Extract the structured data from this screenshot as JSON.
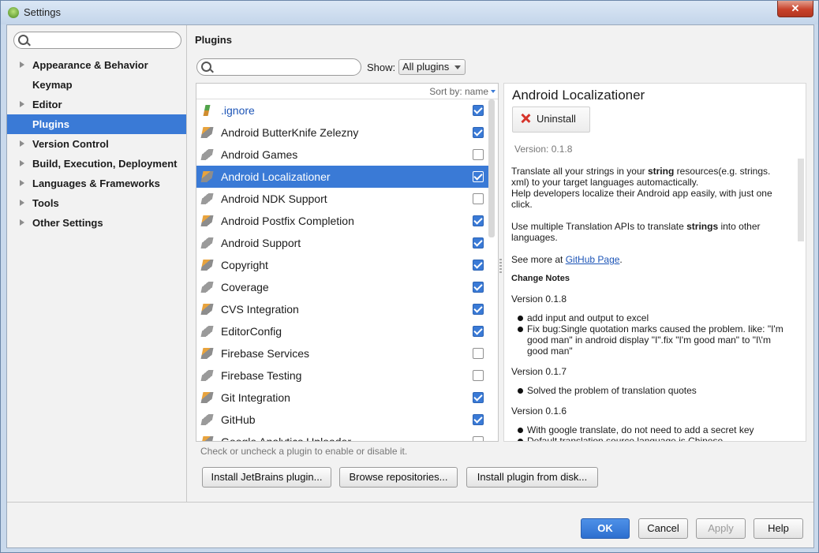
{
  "window": {
    "title": "Settings",
    "close_glyph": "✕"
  },
  "sidebar": {
    "search_placeholder": "",
    "items": [
      {
        "label": "Appearance & Behavior",
        "expandable": true
      },
      {
        "label": "Keymap",
        "expandable": false
      },
      {
        "label": "Editor",
        "expandable": true
      },
      {
        "label": "Plugins",
        "expandable": false,
        "selected": true
      },
      {
        "label": "Version Control",
        "expandable": true
      },
      {
        "label": "Build, Execution, Deployment",
        "expandable": true
      },
      {
        "label": "Languages & Frameworks",
        "expandable": true
      },
      {
        "label": "Tools",
        "expandable": true
      },
      {
        "label": "Other Settings",
        "expandable": true
      }
    ]
  },
  "plugins": {
    "heading": "Plugins",
    "search_placeholder": "",
    "show_label": "Show:",
    "show_value": "All plugins",
    "sort_label": "Sort by: name",
    "list": [
      {
        "name": ".ignore",
        "checked": true,
        "link": true,
        "icon": "green-plug-icon"
      },
      {
        "name": "Android ButterKnife Zelezny",
        "checked": true,
        "icon": "plugin-icon"
      },
      {
        "name": "Android Games",
        "checked": false,
        "icon": "plugin-icon"
      },
      {
        "name": "Android Localizationer",
        "checked": true,
        "selected": true,
        "icon": "plugin-icon"
      },
      {
        "name": "Android NDK Support",
        "checked": false,
        "icon": "plugin-icon"
      },
      {
        "name": "Android Postfix Completion",
        "checked": true,
        "icon": "plugin-icon"
      },
      {
        "name": "Android Support",
        "checked": true,
        "icon": "plugin-icon"
      },
      {
        "name": "Copyright",
        "checked": true,
        "icon": "plugin-icon"
      },
      {
        "name": "Coverage",
        "checked": true,
        "icon": "plugin-icon"
      },
      {
        "name": "CVS Integration",
        "checked": true,
        "icon": "plugin-icon"
      },
      {
        "name": "EditorConfig",
        "checked": true,
        "icon": "plugin-icon"
      },
      {
        "name": "Firebase Services",
        "checked": false,
        "icon": "plugin-icon"
      },
      {
        "name": "Firebase Testing",
        "checked": false,
        "icon": "plugin-icon"
      },
      {
        "name": "Git Integration",
        "checked": true,
        "icon": "plugin-icon"
      },
      {
        "name": "GitHub",
        "checked": true,
        "icon": "plugin-icon"
      },
      {
        "name": "Google Analytics Uploader",
        "checked": false,
        "icon": "plugin-icon"
      }
    ],
    "hint": "Check or uncheck a plugin to enable or disable it.",
    "install_jetbrains": "Install JetBrains plugin...",
    "browse_repos": "Browse repositories...",
    "install_disk": "Install plugin from disk..."
  },
  "detail": {
    "title": "Android Localizationer",
    "uninstall_label": "Uninstall",
    "version": "Version: 0.1.8",
    "desc_1_a": "Translate all your strings in your ",
    "desc_1_b": "string",
    "desc_1_c": " resources(e.g. strings. xml) to your target languages automactically.",
    "desc_2": "Help developers localize their Android app easily, with just one click.",
    "desc_3_a": "Use multiple Translation APIs to translate ",
    "desc_3_b": "strings",
    "desc_3_c": " into other languages.",
    "see_more": "See more at ",
    "github_link": "GitHub Page",
    "period": ".",
    "change_notes": "Change Notes",
    "versions": [
      {
        "label": "Version 0.1.8",
        "items": [
          "add input and output to excel",
          "Fix bug:Single quotation marks caused the problem. like: \"I'm good man\" in android display \"I\".fix \"I'm good man\" to \"I\\'m good man\""
        ]
      },
      {
        "label": "Version 0.1.7",
        "items": [
          "Solved the problem of translation quotes"
        ]
      },
      {
        "label": "Version 0.1.6",
        "items": [
          "With google translate, do not need to add a secret key",
          "Default translation source language is Chinese"
        ]
      }
    ]
  },
  "footer": {
    "ok": "OK",
    "cancel": "Cancel",
    "apply": "Apply",
    "help": "Help"
  }
}
